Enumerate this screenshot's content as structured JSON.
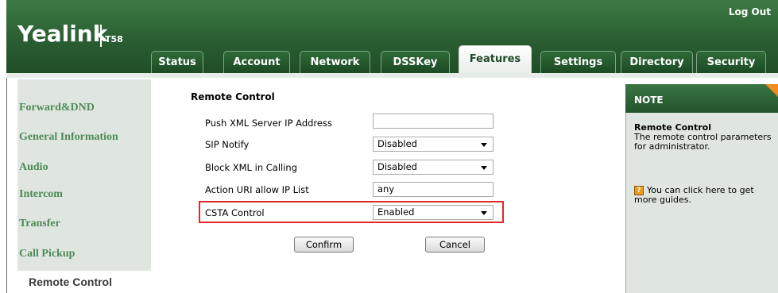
{
  "header": {
    "logo": "Yealink",
    "model": "T58",
    "logout": "Log Out",
    "tabs": [
      {
        "label": "Status"
      },
      {
        "label": "Account"
      },
      {
        "label": "Network"
      },
      {
        "label": "DSSKey"
      },
      {
        "label": "Features"
      },
      {
        "label": "Settings"
      },
      {
        "label": "Directory"
      },
      {
        "label": "Security"
      }
    ],
    "active_tab": "Features"
  },
  "sidebar": {
    "items": [
      {
        "label": "Forward&DND"
      },
      {
        "label": "General Information"
      },
      {
        "label": "Audio"
      },
      {
        "label": "Intercom"
      },
      {
        "label": "Transfer"
      },
      {
        "label": "Call Pickup"
      },
      {
        "label": "Remote Control"
      }
    ],
    "active_item": "Remote Control"
  },
  "main": {
    "section_title": "Remote Control",
    "rows": [
      {
        "label": "Push XML Server IP Address",
        "value": "",
        "type": "text"
      },
      {
        "label": "SIP Notify",
        "value": "Disabled",
        "type": "select"
      },
      {
        "label": "Block XML in Calling",
        "value": "Disabled",
        "type": "select"
      },
      {
        "label": "Action URI allow IP List",
        "value": "any",
        "type": "text"
      },
      {
        "label": "CSTA Control",
        "value": "Enabled",
        "type": "select"
      }
    ],
    "confirm_label": "Confirm",
    "cancel_label": "Cancel",
    "highlight_color": "#e0262b"
  },
  "note": {
    "title": "NOTE",
    "heading": "Remote Control",
    "line1": "The remote control parameters",
    "line2": "for administrator.",
    "help_line1": "You can click here to get",
    "help_line2": "more guides.",
    "help_icon": "help-book-icon"
  },
  "colors": {
    "brand_green": "#2a5e32",
    "link_green": "#4e8a57",
    "panel_bg": "#dfe6e0",
    "note_accent": "#f08c1e"
  }
}
